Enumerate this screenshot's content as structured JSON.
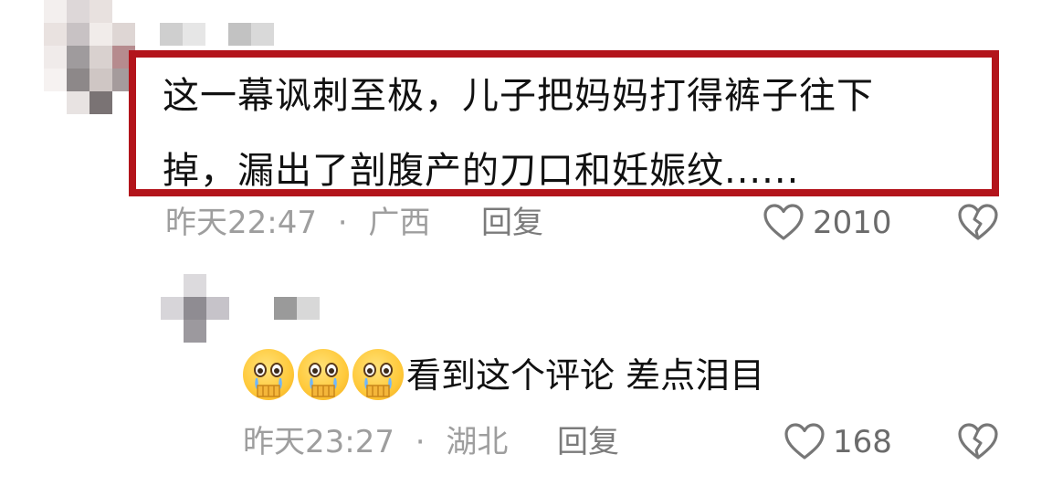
{
  "comment1": {
    "line1": "这一幕讽刺至极，儿子把妈妈打得裤子往下",
    "line2": "掉，漏出了剖腹产的刀口和妊娠纹......",
    "time": "昨天22:47",
    "location": "广西",
    "reply_label": "回复",
    "likes": "2010"
  },
  "comment2": {
    "text": "看到这个评论 差点泪目",
    "emoji_count": 3,
    "time": "昨天23:27",
    "location": "湖北",
    "reply_label": "回复",
    "likes": "168"
  },
  "separator": "·",
  "colors": {
    "highlight_border": "#b3141b",
    "meta_text": "#9e9e9e",
    "icon_stroke": "#777777"
  },
  "icons": [
    "heart-icon",
    "broken-heart-icon",
    "crying-emoji-icon"
  ]
}
